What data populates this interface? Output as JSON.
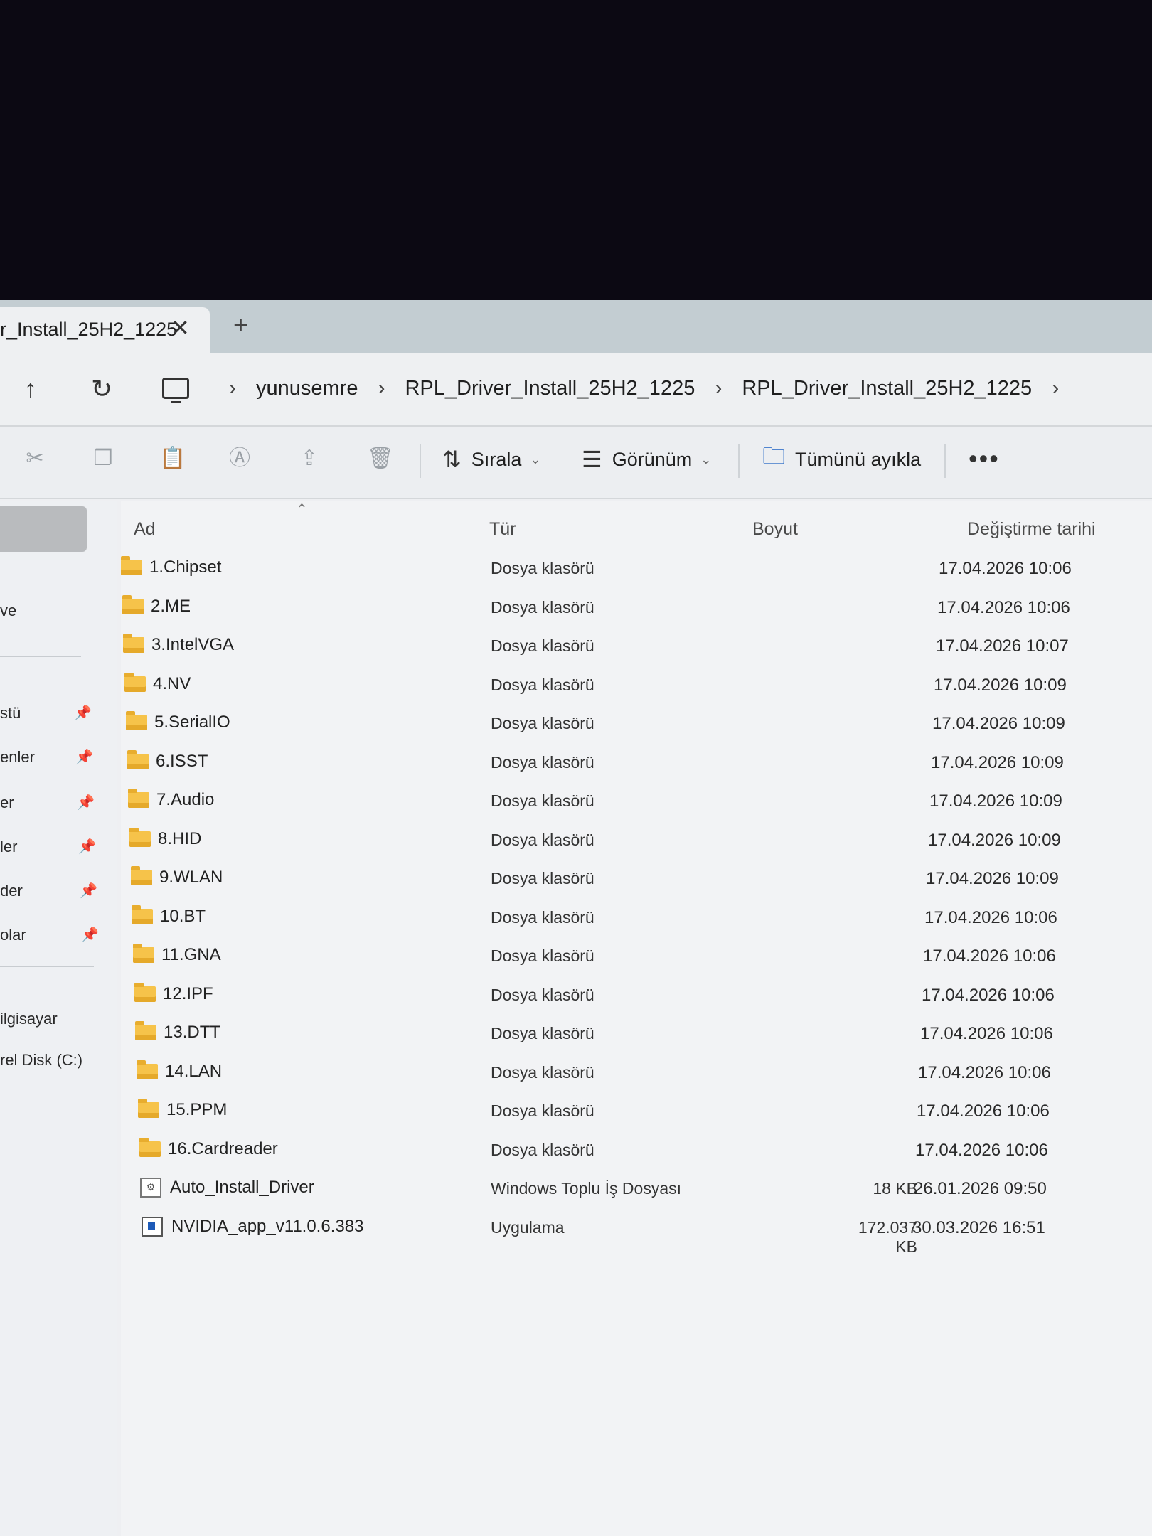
{
  "tab": {
    "title": "r_Install_25H2_1225",
    "close": "✕",
    "new_tab": "+"
  },
  "address": {
    "up": "↑",
    "refresh": "↻",
    "crumbs": [
      "yunusemre",
      "RPL_Driver_Install_25H2_1225",
      "RPL_Driver_Install_25H2_1225"
    ],
    "separator": "›"
  },
  "toolbar": {
    "sort_label": "Sırala",
    "view_label": "Görünüm",
    "extract_label": "Tümünü ayıkla",
    "more_label": "•••"
  },
  "sidebar": {
    "items": [
      "ve",
      "stü",
      "enler",
      "er",
      "ler",
      "der",
      "olar",
      "ilgisayar",
      "rel Disk (C:)"
    ]
  },
  "columns": {
    "name": "Ad",
    "type": "Tür",
    "size": "Boyut",
    "date": "Değiştirme tarihi"
  },
  "files": [
    {
      "icon": "folder",
      "name": "1.Chipset",
      "type": "Dosya klasörü",
      "size": "",
      "date": "17.04.2026 10:06"
    },
    {
      "icon": "folder",
      "name": "2.ME",
      "type": "Dosya klasörü",
      "size": "",
      "date": "17.04.2026 10:06"
    },
    {
      "icon": "folder",
      "name": "3.IntelVGA",
      "type": "Dosya klasörü",
      "size": "",
      "date": "17.04.2026 10:07"
    },
    {
      "icon": "folder",
      "name": "4.NV",
      "type": "Dosya klasörü",
      "size": "",
      "date": "17.04.2026 10:09"
    },
    {
      "icon": "folder",
      "name": "5.SerialIO",
      "type": "Dosya klasörü",
      "size": "",
      "date": "17.04.2026 10:09"
    },
    {
      "icon": "folder",
      "name": "6.ISST",
      "type": "Dosya klasörü",
      "size": "",
      "date": "17.04.2026 10:09"
    },
    {
      "icon": "folder",
      "name": "7.Audio",
      "type": "Dosya klasörü",
      "size": "",
      "date": "17.04.2026 10:09"
    },
    {
      "icon": "folder",
      "name": "8.HID",
      "type": "Dosya klasörü",
      "size": "",
      "date": "17.04.2026 10:09"
    },
    {
      "icon": "folder",
      "name": "9.WLAN",
      "type": "Dosya klasörü",
      "size": "",
      "date": "17.04.2026 10:09"
    },
    {
      "icon": "folder",
      "name": "10.BT",
      "type": "Dosya klasörü",
      "size": "",
      "date": "17.04.2026 10:06"
    },
    {
      "icon": "folder",
      "name": "11.GNA",
      "type": "Dosya klasörü",
      "size": "",
      "date": "17.04.2026 10:06"
    },
    {
      "icon": "folder",
      "name": "12.IPF",
      "type": "Dosya klasörü",
      "size": "",
      "date": "17.04.2026 10:06"
    },
    {
      "icon": "folder",
      "name": "13.DTT",
      "type": "Dosya klasörü",
      "size": "",
      "date": "17.04.2026 10:06"
    },
    {
      "icon": "folder",
      "name": "14.LAN",
      "type": "Dosya klasörü",
      "size": "",
      "date": "17.04.2026 10:06"
    },
    {
      "icon": "folder",
      "name": "15.PPM",
      "type": "Dosya klasörü",
      "size": "",
      "date": "17.04.2026 10:06"
    },
    {
      "icon": "folder",
      "name": "16.Cardreader",
      "type": "Dosya klasörü",
      "size": "",
      "date": "17.04.2026 10:06"
    },
    {
      "icon": "batch",
      "name": "Auto_Install_Driver",
      "type": "Windows Toplu İş Dosyası",
      "size": "18 KB",
      "date": "26.01.2026 09:50"
    },
    {
      "icon": "app",
      "name": "NVIDIA_app_v11.0.6.383",
      "type": "Uygulama",
      "size": "172.037 KB",
      "date": "30.03.2026 16:51"
    }
  ]
}
